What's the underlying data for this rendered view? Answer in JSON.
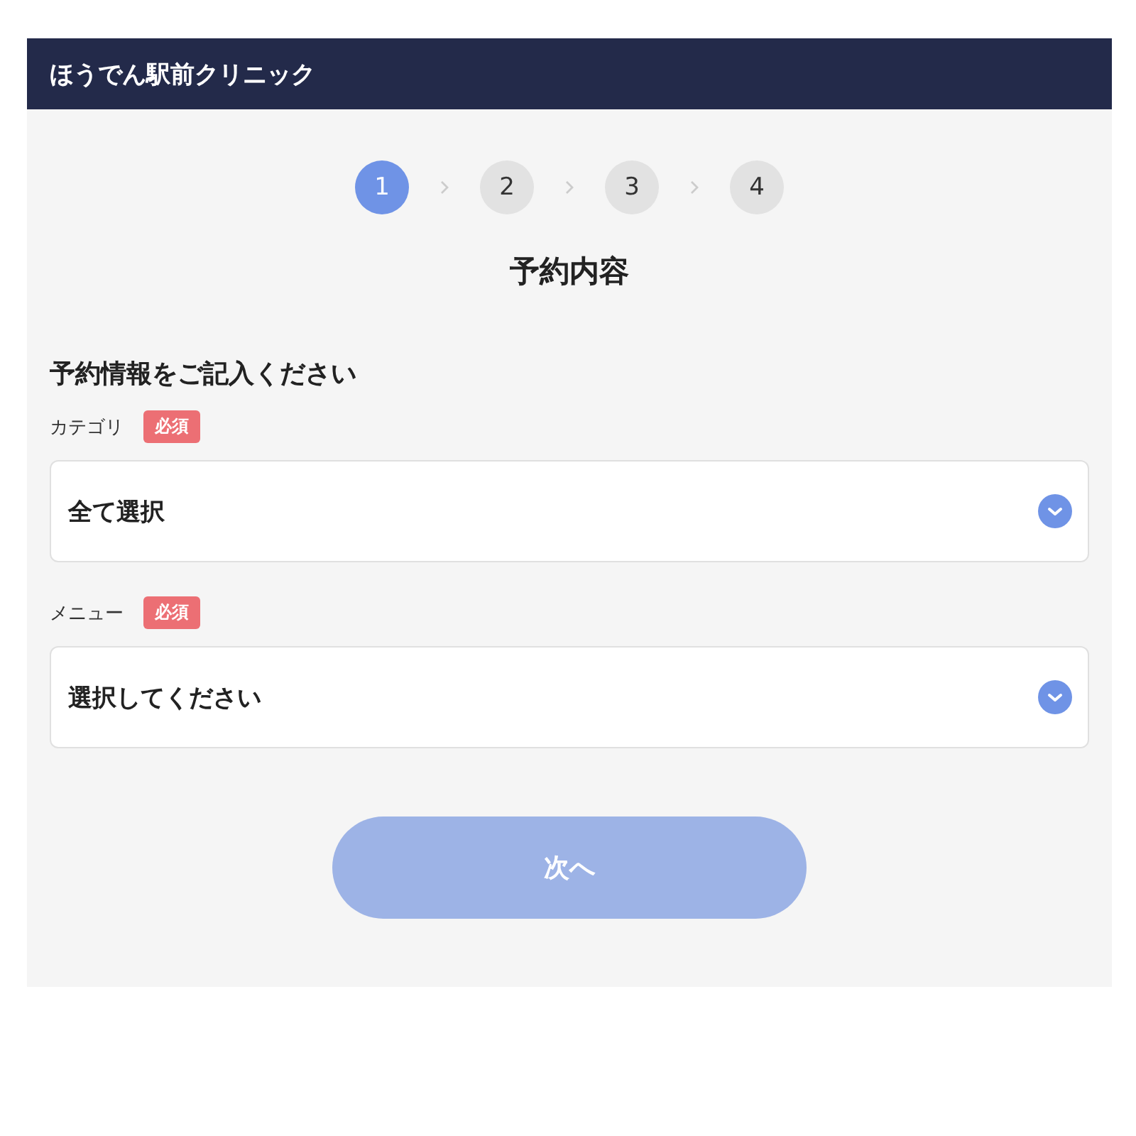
{
  "header": {
    "title": "ほうでん駅前クリニック"
  },
  "steps": [
    {
      "label": "1",
      "selected": true
    },
    {
      "label": "2",
      "selected": false
    },
    {
      "label": "3",
      "selected": false
    },
    {
      "label": "4",
      "selected": false
    }
  ],
  "page_title": "予約内容",
  "section_title": "予約情報をご記入ください",
  "fields": [
    {
      "label": "カテゴリ",
      "badge": "必須",
      "value": "全て選択"
    },
    {
      "label": "メニュー",
      "badge": "必須",
      "value": "選択してください"
    }
  ],
  "next_button": {
    "label": "次へ",
    "disabled": true
  }
}
